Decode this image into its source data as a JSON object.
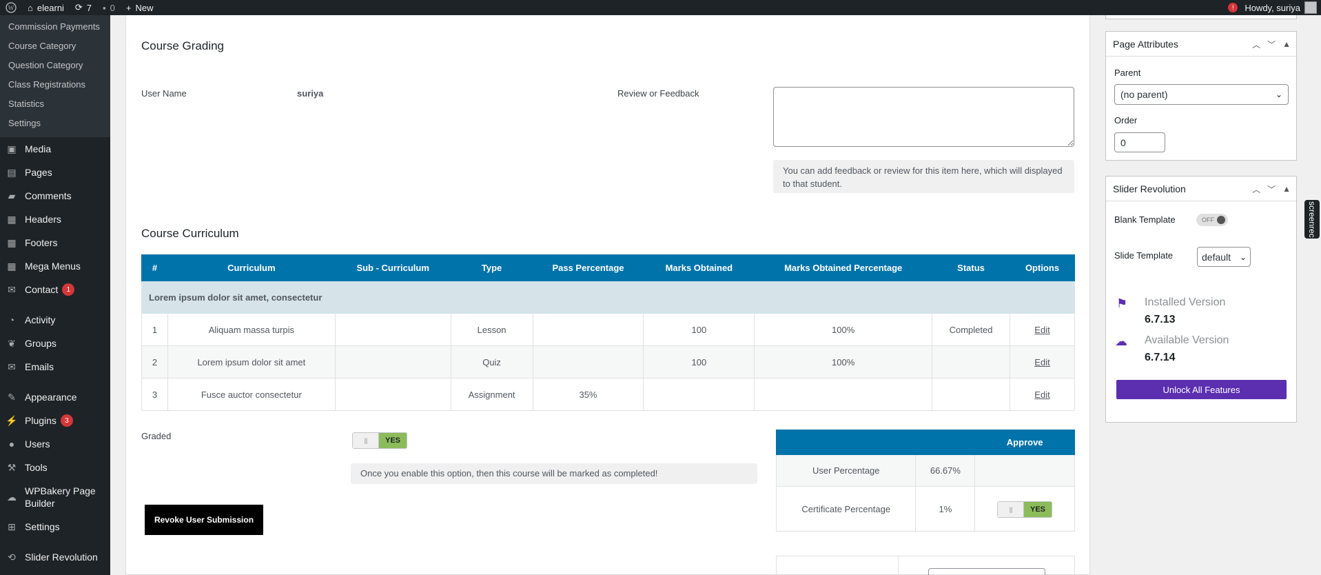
{
  "adminbar": {
    "site_name": "elearni",
    "updates_count": "7",
    "comments_count": "0",
    "new_label": "New",
    "notification_count": "!",
    "howdy": "Howdy, suriya"
  },
  "sidebar": {
    "submenu": [
      "Commission Payments",
      "Course Category",
      "Question Category",
      "Class Registrations",
      "Statistics",
      "Settings"
    ],
    "items": [
      {
        "label": "Media",
        "icon": "media-icon"
      },
      {
        "label": "Pages",
        "icon": "pages-icon"
      },
      {
        "label": "Comments",
        "icon": "comments-icon"
      },
      {
        "label": "Headers",
        "icon": "grid-icon"
      },
      {
        "label": "Footers",
        "icon": "grid-icon"
      },
      {
        "label": "Mega Menus",
        "icon": "grid-icon"
      },
      {
        "label": "Contact",
        "icon": "mail-icon",
        "badge": "1"
      },
      {
        "label": "Activity",
        "icon": "activity-icon"
      },
      {
        "label": "Groups",
        "icon": "groups-icon"
      },
      {
        "label": "Emails",
        "icon": "mail-icon"
      },
      {
        "label": "Appearance",
        "icon": "brush-icon"
      },
      {
        "label": "Plugins",
        "icon": "plugin-icon",
        "badge": "3"
      },
      {
        "label": "Users",
        "icon": "user-icon"
      },
      {
        "label": "Tools",
        "icon": "wrench-icon"
      },
      {
        "label": "WPBakery Page Builder",
        "icon": "cloud-icon"
      },
      {
        "label": "Settings",
        "icon": "settings-icon"
      },
      {
        "label": "Slider Revolution",
        "icon": "refresh-icon"
      }
    ]
  },
  "grading": {
    "title": "Course Grading",
    "user_name_label": "User Name",
    "user_name_value": "suriya",
    "feedback_label": "Review or Feedback",
    "feedback_hint": "You can add feedback or review for this item here, which will displayed to that student."
  },
  "curriculum": {
    "title": "Course Curriculum",
    "headers": [
      "#",
      "Curriculum",
      "Sub - Curriculum",
      "Type",
      "Pass Percentage",
      "Marks Obtained",
      "Marks Obtained Percentage",
      "Status",
      "Options"
    ],
    "section": "Lorem ipsum dolor sit amet, consectetur",
    "rows": [
      {
        "num": "1",
        "name": "Aliquam massa turpis",
        "sub": "",
        "type": "Lesson",
        "pass": "",
        "marks": "100",
        "pct": "100%",
        "status": "Completed",
        "option": "Edit"
      },
      {
        "num": "2",
        "name": "Lorem ipsum dolor sit amet",
        "sub": "",
        "type": "Quiz",
        "pass": "",
        "marks": "100",
        "pct": "100%",
        "status": "",
        "option": "Edit"
      },
      {
        "num": "3",
        "name": "Fusce auctor consectetur",
        "sub": "",
        "type": "Assignment",
        "pass": "35%",
        "marks": "",
        "pct": "",
        "status": "",
        "option": "Edit"
      }
    ]
  },
  "graded": {
    "label": "Graded",
    "toggle_on": "YES",
    "knob": "|||",
    "hint": "Once you enable this option, then this course will be marked as completed!"
  },
  "approve": {
    "header": "Approve",
    "user_pct_label": "User Percentage",
    "user_pct_value": "66.67%",
    "cert_pct_label": "Certificate Percentage",
    "cert_pct_value": "1%",
    "toggle_on": "YES"
  },
  "revoke_label": "Revoke User Submission",
  "page_attributes": {
    "title": "Page Attributes",
    "parent_label": "Parent",
    "parent_value": "(no parent)",
    "order_label": "Order",
    "order_value": "0"
  },
  "slider_revolution": {
    "title": "Slider Revolution",
    "blank_template_label": "Blank Template",
    "blank_toggle": "OFF",
    "slide_template_label": "Slide Template",
    "slide_template_value": "default",
    "installed_label": "Installed Version",
    "installed_value": "6.7.13",
    "available_label": "Available Version",
    "available_value": "6.7.14",
    "unlock_label": "Unlock All Features"
  },
  "screenrec_label": "screenrec",
  "colors": {
    "accent_blue": "#0073aa",
    "purple": "#5b2fb0",
    "toggle_green": "#8cbc5a",
    "admin_dark": "#1d2327"
  }
}
